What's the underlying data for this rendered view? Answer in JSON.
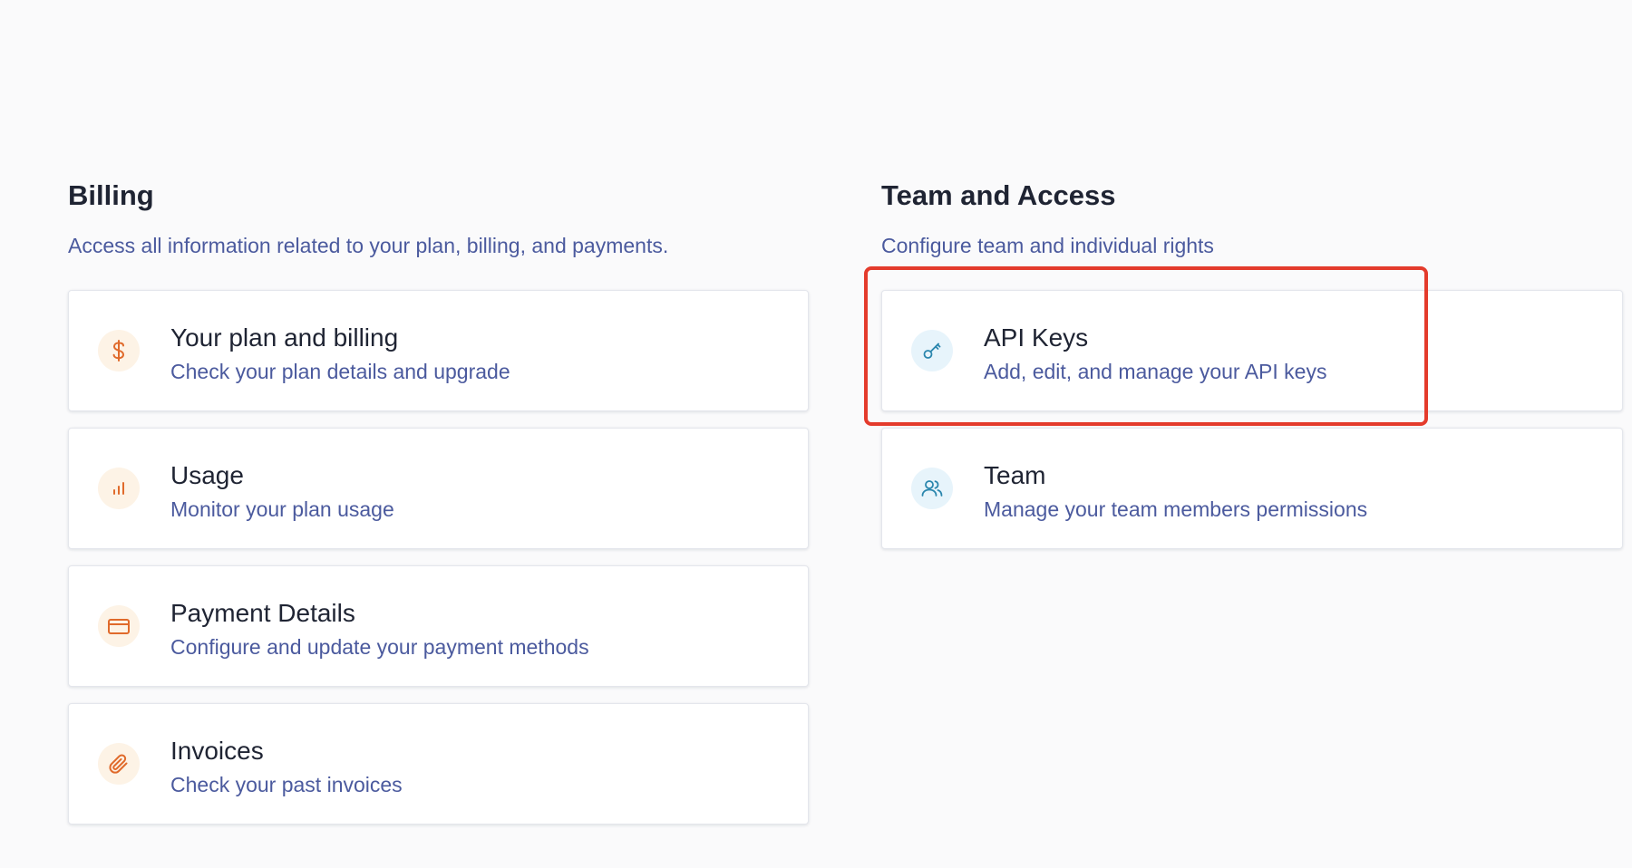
{
  "billing": {
    "title": "Billing",
    "subtitle": "Access all information related to your plan, billing, and payments.",
    "cards": [
      {
        "title": "Your plan and billing",
        "description": "Check your plan details and upgrade",
        "icon": "dollar-icon"
      },
      {
        "title": "Usage",
        "description": "Monitor your plan usage",
        "icon": "bar-chart-icon"
      },
      {
        "title": "Payment Details",
        "description": "Configure and update your payment methods",
        "icon": "credit-card-icon"
      },
      {
        "title": "Invoices",
        "description": "Check your past invoices",
        "icon": "paperclip-icon"
      }
    ]
  },
  "team_access": {
    "title": "Team and Access",
    "subtitle": "Configure team and individual rights",
    "cards": [
      {
        "title": "API Keys",
        "description": "Add, edit, and manage your API keys",
        "icon": "key-icon"
      },
      {
        "title": "Team",
        "description": "Manage your team members permissions",
        "icon": "users-icon"
      }
    ]
  },
  "colors": {
    "billing_icon": "#e06a2b",
    "billing_icon_bg": "#fdf3e6",
    "team_icon": "#2a86ad",
    "team_icon_bg": "#e7f4fb",
    "subtitle_text": "#4b5a9e",
    "highlight": "#e43b2c"
  }
}
